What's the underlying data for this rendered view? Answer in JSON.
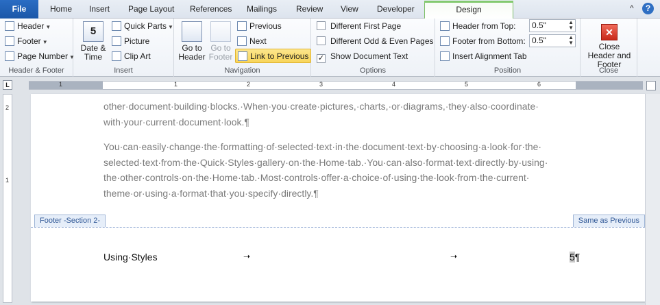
{
  "tabs": {
    "file": "File",
    "home": "Home",
    "insert": "Insert",
    "page_layout": "Page Layout",
    "references": "References",
    "mailings": "Mailings",
    "review": "Review",
    "view": "View",
    "developer": "Developer",
    "design": "Design"
  },
  "ribbon": {
    "header_footer": {
      "header": "Header",
      "footer": "Footer",
      "page_number": "Page Number",
      "label": "Header & Footer"
    },
    "insert": {
      "date_time": "Date & Time",
      "quick_parts": "Quick Parts",
      "picture": "Picture",
      "clip_art": "Clip Art",
      "label": "Insert"
    },
    "navigation": {
      "go_to_header": "Go to Header",
      "go_to_footer": "Go to Footer",
      "previous": "Previous",
      "next": "Next",
      "link_to_previous": "Link to Previous",
      "label": "Navigation"
    },
    "options": {
      "different_first_page": "Different First Page",
      "different_odd_even": "Different Odd & Even Pages",
      "show_document_text": "Show Document Text",
      "label": "Options",
      "different_first_page_checked": false,
      "different_odd_even_checked": false,
      "show_document_text_checked": true
    },
    "position": {
      "header_from_top_label": "Header from Top:",
      "header_from_top_value": "0.5\"",
      "footer_from_bottom_label": "Footer from Bottom:",
      "footer_from_bottom_value": "0.5\"",
      "insert_alignment_tab": "Insert Alignment Tab",
      "label": "Position"
    },
    "close": {
      "close_header_footer": "Close Header and Footer",
      "label": "Close"
    }
  },
  "ruler": {
    "numbers": [
      "1",
      "1",
      "2",
      "3",
      "4",
      "5",
      "6"
    ],
    "vertical_numbers": [
      "2",
      "1"
    ]
  },
  "document": {
    "para1_line1": "other·document·building·blocks.·When·you·create·pictures,·charts,·or·diagrams,·they·also·coordinate·",
    "para1_line2": "with·your·current·document·look.¶",
    "para2_line1": "You·can·easily·change·the·formatting·of·selected·text·in·the·document·text·by·choosing·a·look·for·the·",
    "para2_line2": "selected·text·from·the·Quick·Styles·gallery·on·the·Home·tab.·You·can·also·format·text·directly·by·using·",
    "para2_line3": "the·other·controls·on·the·Home·tab.·Most·controls·offer·a·choice·of·using·the·look·from·the·current·",
    "para2_line4": "theme·or·using·a·format·that·you·specify·directly.¶",
    "footer_tag": "Footer -Section 2-",
    "same_as_previous": "Same as Previous",
    "footer_text": "Using·Styles",
    "page_number": "5",
    "pilcrow": "¶"
  },
  "icons": {
    "help": "?",
    "minimize_ribbon": "^"
  }
}
